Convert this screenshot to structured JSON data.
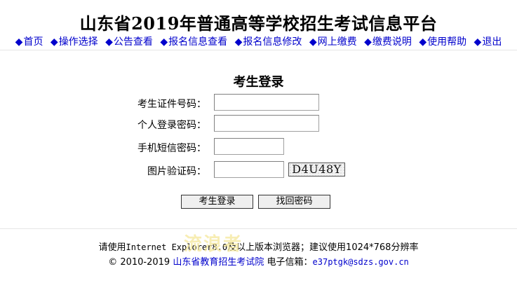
{
  "header": {
    "title": "山东省2019年普通高等学校招生考试信息平台"
  },
  "nav": {
    "bullet": "◆",
    "items": [
      {
        "label": "首页"
      },
      {
        "label": "操作选择"
      },
      {
        "label": "公告查看"
      },
      {
        "label": "报名信息查看"
      },
      {
        "label": "报名信息修改"
      },
      {
        "label": "网上缴费"
      },
      {
        "label": "缴费说明"
      },
      {
        "label": "使用帮助"
      },
      {
        "label": "退出"
      }
    ]
  },
  "login": {
    "title": "考生登录",
    "fields": {
      "exam_id": {
        "label": "考生证件号码：",
        "value": ""
      },
      "password": {
        "label": "个人登录密码：",
        "value": ""
      },
      "sms_code": {
        "label": "手机短信密码：",
        "value": ""
      },
      "captcha": {
        "label": "图片验证码：",
        "value": ""
      }
    },
    "captcha_image_text": "D4U48Y",
    "buttons": {
      "login": "考生登录",
      "recover": "找回密码"
    }
  },
  "footer": {
    "notice_prefix": "请使用",
    "notice_browser": "Internet Explorer8.0",
    "notice_suffix": "及以上版本浏览器；建议使用1024*768分辨率",
    "copyright": "© 2010-2019",
    "org_link": "山东省教育招生考试院",
    "email_label": "电子信箱：",
    "email": "e37ptgk@sdzs.gov.cn"
  },
  "watermark": "流浪者",
  "colors": {
    "link": "#0000cc",
    "watermark": "#f5e79a"
  }
}
